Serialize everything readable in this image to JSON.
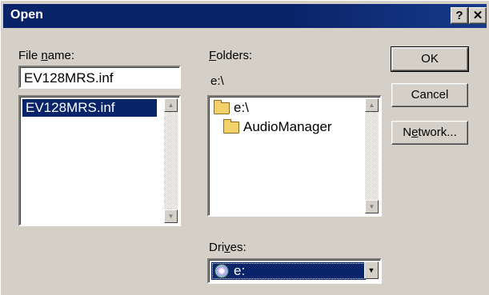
{
  "window": {
    "title": "Open",
    "help_label": "?",
    "close_label": "✕"
  },
  "file_name": {
    "label_pre": "File ",
    "label_accel": "n",
    "label_post": "ame:",
    "value": "EV128MRS.inf",
    "list": [
      {
        "label": "EV128MRS.inf",
        "selected": true
      }
    ]
  },
  "folders": {
    "label_accel": "F",
    "label_post": "olders:",
    "current_path": "e:\\",
    "tree": [
      {
        "label": "e:\\",
        "icon": "open-folder-icon"
      },
      {
        "label": "AudioManager",
        "icon": "folder-icon"
      }
    ]
  },
  "drives": {
    "label_pre": "Dri",
    "label_accel": "v",
    "label_post": "es:",
    "selected": "e:",
    "icon": "cd-drive-icon"
  },
  "buttons": {
    "ok": "OK",
    "cancel": "Cancel",
    "network_pre": "N",
    "network_accel": "e",
    "network_post": "twork..."
  },
  "colors": {
    "title_bar": "#0a246a",
    "selection": "#0a246a",
    "face": "#d4d0c8"
  }
}
